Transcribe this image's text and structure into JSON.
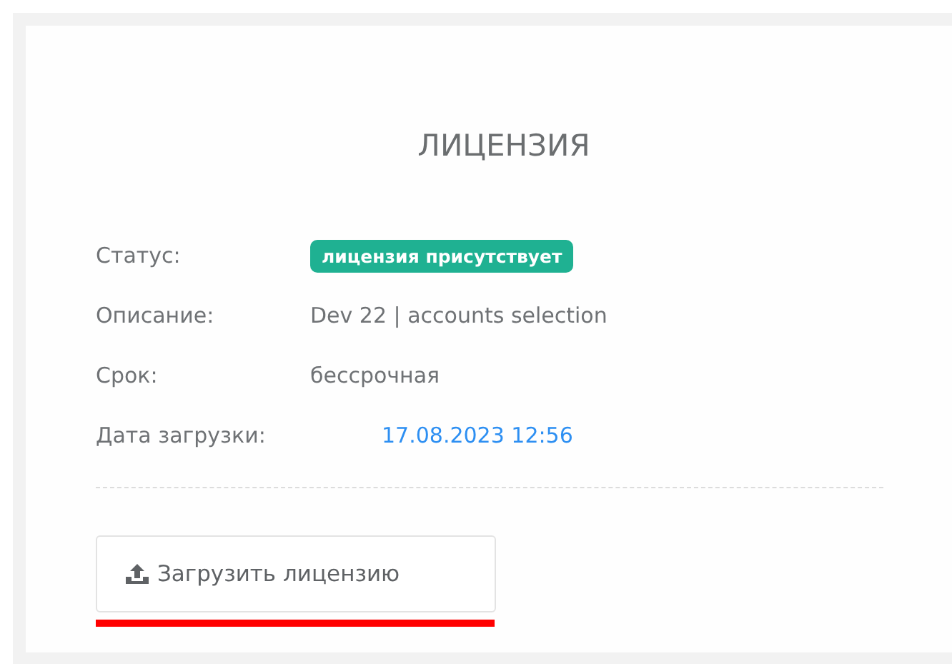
{
  "card": {
    "title": "ЛИЦЕНЗИЯ",
    "fields": [
      {
        "label": "Статус:",
        "value": "лицензия присутствует",
        "kind": "badge"
      },
      {
        "label": "Описание:",
        "value": "Dev 22 | accounts selection",
        "kind": "text"
      },
      {
        "label": "Срок:",
        "value": "бессрочная",
        "kind": "text"
      },
      {
        "label": "Дата загрузки:",
        "value": "17.08.2023 12:56",
        "kind": "link"
      }
    ],
    "button": {
      "label": "Загрузить лицензию",
      "underlined": true
    }
  }
}
